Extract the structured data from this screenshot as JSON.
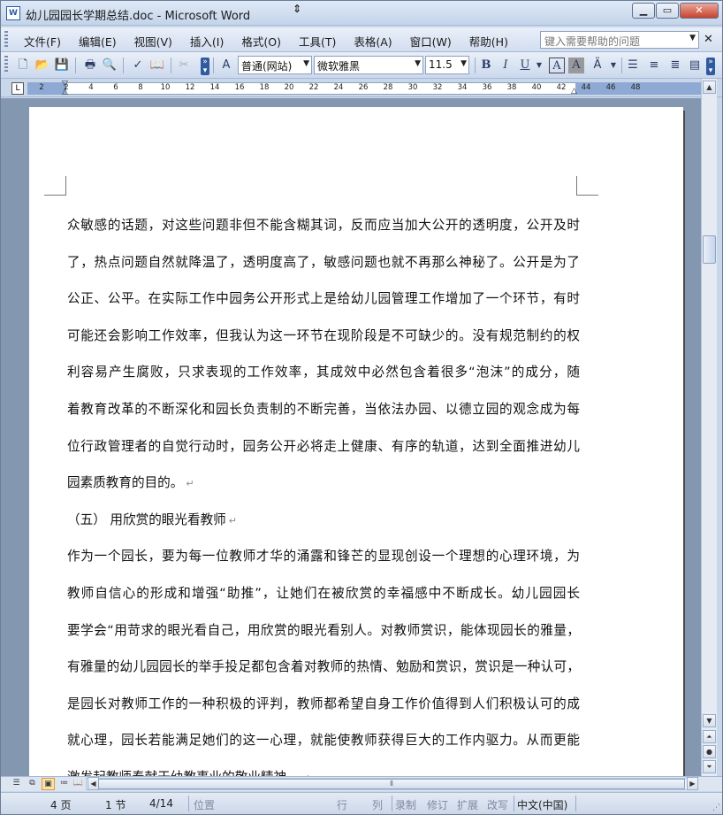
{
  "window": {
    "title": "幼儿园园长学期总结.doc - Microsoft Word",
    "app_icon_letter": "W"
  },
  "menu": {
    "items": [
      "文件(F)",
      "编辑(E)",
      "视图(V)",
      "插入(I)",
      "格式(O)",
      "工具(T)",
      "表格(A)",
      "窗口(W)",
      "帮助(H)"
    ],
    "help_placeholder": "键入需要帮助的问题"
  },
  "toolbar": {
    "style_value": "普通(网站)",
    "font_value": "微软雅黑",
    "size_value": "11.5",
    "bold": "B",
    "italic": "I",
    "underline": "U",
    "font_color_label": "A",
    "char_shading_label": "A"
  },
  "ruler": {
    "numbers": [
      "2",
      "2",
      "4",
      "6",
      "8",
      "10",
      "12",
      "14",
      "16",
      "18",
      "20",
      "22",
      "24",
      "26",
      "28",
      "30",
      "32",
      "34",
      "36",
      "38",
      "40",
      "42",
      "44",
      "46",
      "48"
    ],
    "tab_selector": "L"
  },
  "document": {
    "lines": [
      {
        "text": "众敏感的话题，对这些问题非但不能含糊其词，反而应当加大公开的透明度，公开及时",
        "para_end": false
      },
      {
        "text": "了，热点问题自然就降温了，透明度高了，敏感问题也就不再那么神秘了。公开是为了",
        "para_end": false
      },
      {
        "text": "公正、公平。在实际工作中园务公开形式上是给幼儿园管理工作增加了一个环节，有时",
        "para_end": false
      },
      {
        "text": "可能还会影响工作效率，但我认为这一环节在现阶段是不可缺少的。没有规范制约的权",
        "para_end": false
      },
      {
        "text": "利容易产生腐败，只求表现的工作效率，其成效中必然包含着很多“泡沫”的成分，随",
        "para_end": false
      },
      {
        "text": "着教育改革的不断深化和园长负责制的不断完善，当依法办园、以德立园的观念成为每",
        "para_end": false
      },
      {
        "text": "位行政管理者的自觉行动时，园务公开必将走上健康、有序的轨道，达到全面推进幼儿",
        "para_end": false
      },
      {
        "text": "园素质教育的目的。",
        "para_end": true
      },
      {
        "text": "（五） 用欣赏的眼光看教师",
        "para_end": true
      },
      {
        "text": "作为一个园长，要为每一位教师才华的涌露和锋芒的显现创设一个理想的心理环境，为",
        "para_end": false
      },
      {
        "text": "教师自信心的形成和增强“助推”，让她们在被欣赏的幸福感中不断成长。幼儿园园长",
        "para_end": false
      },
      {
        "text": "要学会“用苛求的眼光看自己，用欣赏的眼光看别人。对教师赏识，能体现园长的雅量，",
        "para_end": false
      },
      {
        "text": "有雅量的幼儿园园长的举手投足都包含着对教师的热情、勉励和赏识，赏识是一种认可，",
        "para_end": false
      },
      {
        "text": "是园长对教师工作的一种积极的评判，教师都希望自身工作价值得到人们积极认可的成",
        "para_end": false
      },
      {
        "text": "就心理，园长若能满足她们的这一心理，就能使教师获得巨大的工作内驱力。从而更能",
        "para_end": false
      },
      {
        "text": "激发起教师奉献于幼教事业的敬业精神。",
        "para_end": true
      }
    ],
    "paragraph_mark": "↵"
  },
  "status": {
    "page": "4 页",
    "section": "1 节",
    "page_of": "4/14",
    "position": "位置",
    "line": "行",
    "column": "列",
    "rec": "录制",
    "trk": "修订",
    "ext": "扩展",
    "ovr": "改写",
    "language": "中文(中国)"
  }
}
